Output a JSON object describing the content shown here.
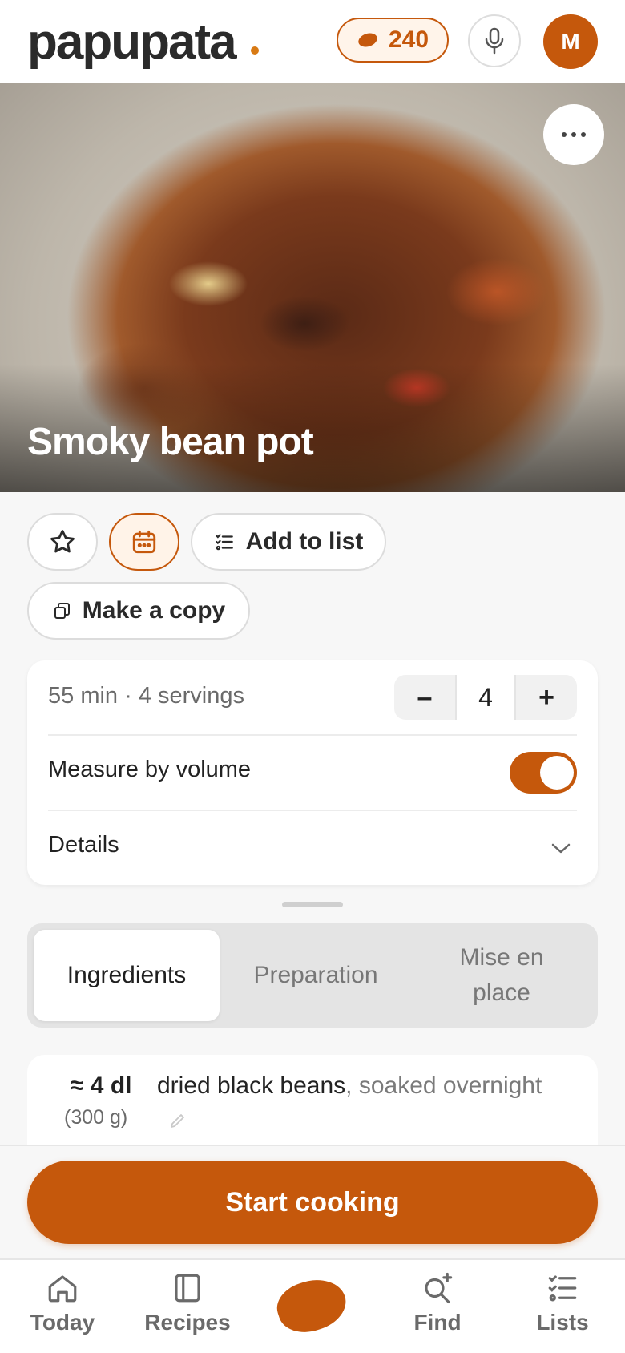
{
  "header": {
    "logo": "papupata",
    "credits": "240",
    "avatar_initial": "M"
  },
  "recipe": {
    "title": "Smoky bean pot"
  },
  "actions": {
    "add_to_list": "Add to list",
    "make_copy": "Make a copy"
  },
  "info_card": {
    "meta": "55 min · 4 servings",
    "servings_decrement": "–",
    "servings_value": "4",
    "servings_increment": "+",
    "measure_label": "Measure by volume",
    "measure_enabled": true,
    "details_label": "Details"
  },
  "tabs": [
    {
      "label": "Ingredients",
      "active": true
    },
    {
      "label": "Preparation",
      "active": false
    },
    {
      "label": "Mise en place",
      "active": false
    }
  ],
  "ingredients": [
    {
      "amount": "≈ 4 dl",
      "grams": "(300 g)",
      "name": "dried black beans",
      "note": ", soaked overnight"
    }
  ],
  "cta": {
    "label": "Start cooking"
  },
  "nav": [
    {
      "label": "Today",
      "icon": "home-icon"
    },
    {
      "label": "Recipes",
      "icon": "book-icon"
    },
    {
      "label": "",
      "icon": "bean-icon"
    },
    {
      "label": "Find",
      "icon": "search-plus-icon"
    },
    {
      "label": "Lists",
      "icon": "checklist-icon"
    }
  ],
  "colors": {
    "accent": "#c5580c",
    "background": "#f7f7f7"
  }
}
